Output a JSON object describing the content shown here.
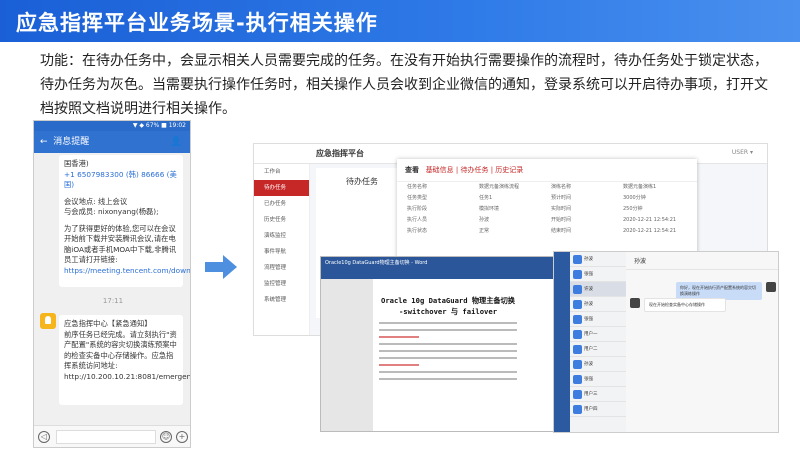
{
  "title": "应急指挥平台业务场景-执行相关操作",
  "description": "功能：在待办任务中，会显示相关人员需要完成的任务。在没有开始执行需要操作的流程时，待办任务处于锁定状态，待办任务为灰色。当需要执行操作任务时，相关操作人员会收到企业微信的通知，登录系统可以开启待办事项，打开文档按照文档说明进行相关操作。",
  "phone": {
    "header_title": "消息提醒",
    "message1_lines": [
      "国香港)",
      "+1 6507983300 (韩) 86666 (美国)",
      "",
      "会议地点: 线上会议",
      "与会成员: nixonyang(杨磊);",
      "",
      "为了获得更好的体验,您可以在会议开始前下载并安装腾讯会议,请在电脑iOA或者手机MOA中下载,非腾讯员工请打开链接:",
      "https://meeting.tencent.com/download.html"
    ],
    "time_label": "17:11",
    "message2_lines": [
      "应急指挥中心【紧急通知】",
      "前序任务已经完成。请立刻执行\"资产配置\"系统的容灾切换演练预案中的检查实备中心存储操作。应急指挥系统访问地址: http://10.200.10.21:8081/emergency"
    ]
  },
  "webapp": {
    "app_title": "应急指挥平台",
    "user_label": "USER ▾",
    "sidebar": [
      "工作台",
      "待办任务",
      "已办任务",
      "历史任务",
      "演练监控",
      "事件导航",
      "流程管理",
      "监控管理",
      "系统管理"
    ],
    "main_heading": "待办任务",
    "dialog_title": "查看",
    "dialog_sub": "基础信息 | 待办任务 | 历史记录",
    "dialog_rows": [
      [
        "任务名称",
        "数据元备演练流程",
        "演练名称",
        "数据元备演练1"
      ],
      [
        "任务类型",
        "任务1",
        "预计时间",
        "3000分钟"
      ],
      [
        "执行阶段",
        "模拟环境",
        "实际时间",
        "250分钟"
      ],
      [
        "执行人员",
        "孙波",
        "开始时间",
        "2020-12-21 12:54:21"
      ],
      [
        "执行状态",
        "正常",
        "结束时间",
        "2020-12-21 12:54:21"
      ]
    ]
  },
  "word": {
    "doc_title_line1": "Oracle 10g DataGuard 物理主备切换",
    "doc_title_line2": "-switchover 与 failover",
    "toolbar_text": "Oracle10g DataGuard物理主备切换 - Word"
  },
  "chat": {
    "contact_name": "孙波",
    "list": [
      "孙波",
      "张强",
      "许波",
      "孙波",
      "张强",
      "用户一",
      "用户二",
      "孙波",
      "张强",
      "用户三",
      "用户四"
    ],
    "msg_right": "你好，现在开始执行资产配置系统的容灾切换演练操作",
    "msg_left": "现在开始检查实备中心存储操作"
  }
}
